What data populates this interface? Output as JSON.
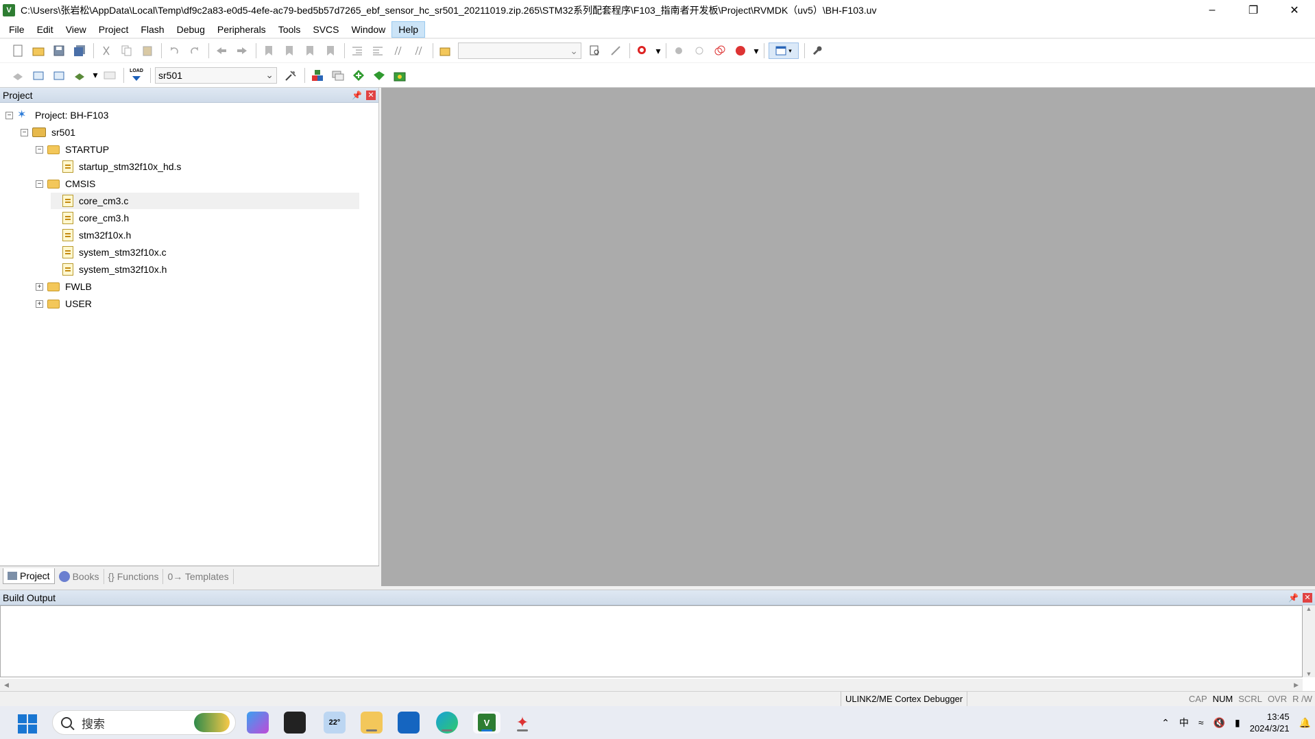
{
  "window": {
    "title": "C:\\Users\\张岩松\\AppData\\Local\\Temp\\df9c2a83-e0d5-4efe-ac79-bed5b57d7265_ebf_sensor_hc_sr501_20211019.zip.265\\STM32系列配套程序\\F103_指南者开发板\\Project\\RVMDK（uv5）\\BH-F103.uv",
    "app_icon_text": "V"
  },
  "menu": [
    "File",
    "Edit",
    "View",
    "Project",
    "Flash",
    "Debug",
    "Peripherals",
    "Tools",
    "SVCS",
    "Window",
    "Help"
  ],
  "toolbar2": {
    "target": "sr501",
    "load_label": "LOAD"
  },
  "project_panel": {
    "title": "Project",
    "tree": [
      {
        "label": "Project: BH-F103",
        "type": "project",
        "level": 0,
        "expander": "−"
      },
      {
        "label": "sr501",
        "type": "target",
        "level": 1,
        "expander": "−"
      },
      {
        "label": "STARTUP",
        "type": "folder",
        "level": 2,
        "expander": "−"
      },
      {
        "label": "startup_stm32f10x_hd.s",
        "type": "file",
        "level": 3
      },
      {
        "label": "CMSIS",
        "type": "folder",
        "level": 2,
        "expander": "−"
      },
      {
        "label": "core_cm3.c",
        "type": "file",
        "level": 3,
        "selected": true
      },
      {
        "label": "core_cm3.h",
        "type": "file",
        "level": 3
      },
      {
        "label": "stm32f10x.h",
        "type": "file",
        "level": 3
      },
      {
        "label": "system_stm32f10x.c",
        "type": "file",
        "level": 3
      },
      {
        "label": "system_stm32f10x.h",
        "type": "file",
        "level": 3
      },
      {
        "label": "FWLB",
        "type": "folder",
        "level": 2,
        "expander": "+"
      },
      {
        "label": "USER",
        "type": "folder",
        "level": 2,
        "expander": "+"
      }
    ],
    "tabs": [
      "Project",
      "Books",
      "{} Functions",
      "0→ Templates"
    ]
  },
  "build_panel": {
    "title": "Build Output"
  },
  "status": {
    "debugger": "ULINK2/ME Cortex Debugger",
    "keys": [
      "CAP",
      "NUM",
      "SCRL",
      "OVR",
      "R /W"
    ]
  },
  "taskbar": {
    "search_placeholder": "搜索",
    "weather_temp": "22°",
    "ime": "中",
    "time": "13:45",
    "date": "2024/3/21"
  }
}
